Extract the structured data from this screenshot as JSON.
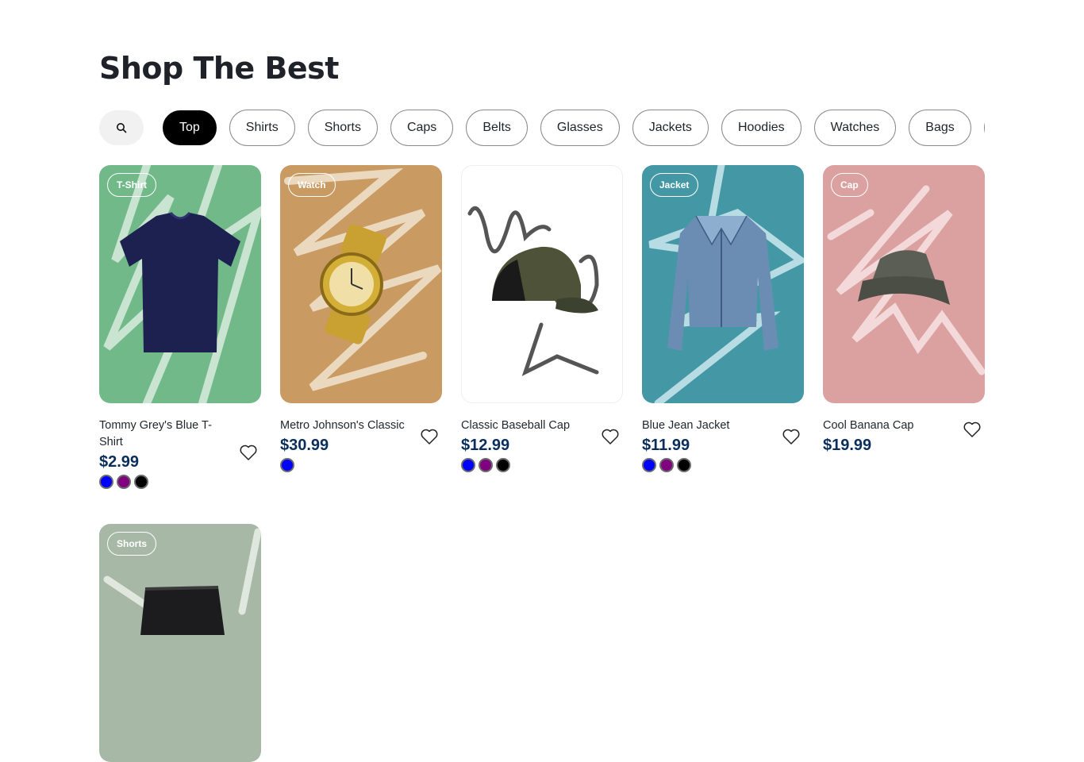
{
  "page": {
    "title": "Shop The Best"
  },
  "search": {
    "icon": "search-icon"
  },
  "filters": [
    {
      "label": "Top",
      "active": true
    },
    {
      "label": "Shirts"
    },
    {
      "label": "Shorts"
    },
    {
      "label": "Caps"
    },
    {
      "label": "Belts"
    },
    {
      "label": "Glasses"
    },
    {
      "label": "Jackets"
    },
    {
      "label": "Hoodies"
    },
    {
      "label": "Watches"
    },
    {
      "label": "Bags"
    },
    {
      "label": "P"
    }
  ],
  "products": [
    {
      "tag": "T-Shirt",
      "name": "Tommy Grey's Blue T-Shirt",
      "price": "$2.99",
      "bg": "#72b98a",
      "colors": [
        "#0000ff",
        "#800080",
        "#000000"
      ]
    },
    {
      "tag": "Watch",
      "name": "Metro Johnson's Classic",
      "price": "$30.99",
      "bg": "#c99b63",
      "colors": [
        "#0000ff"
      ]
    },
    {
      "tag": "",
      "name": "Classic Baseball Cap",
      "price": "$12.99",
      "bg": "#ffffff",
      "colors": [
        "#0000ff",
        "#800080",
        "#000000"
      ]
    },
    {
      "tag": "Jacket",
      "name": "Blue Jean Jacket",
      "price": "$11.99",
      "bg": "#4498a6",
      "colors": [
        "#0000ff",
        "#800080",
        "#000000"
      ]
    },
    {
      "tag": "Cap",
      "name": "Cool Banana Cap",
      "price": "$19.99",
      "bg": "#dba0a0",
      "colors": []
    },
    {
      "tag": "Shorts",
      "name": "",
      "price": "",
      "bg": "#a8b8a6",
      "colors": []
    }
  ],
  "icons": {
    "favorite": "heart-icon"
  }
}
